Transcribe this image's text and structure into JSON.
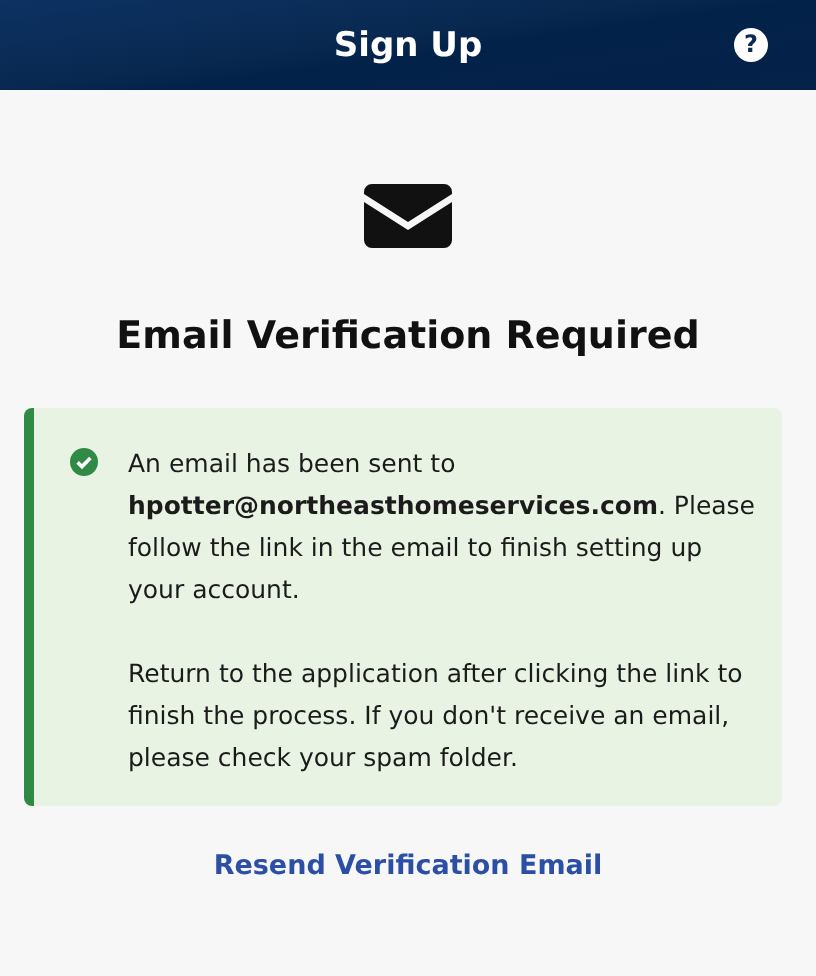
{
  "header": {
    "title": "Sign Up",
    "help_icon": "?"
  },
  "heading": "Email Verification Required",
  "alert": {
    "kind": "success",
    "paragraphs": [
      "An email has been sent to **hpotter@northeasthomeservices.com**. Please follow the link in the email to finish setting up your account.",
      "Return to the application after clicking the link to finish the process. If you don't receive an email, please check your spam folder."
    ]
  },
  "resend_link": "Resend Verification Email"
}
